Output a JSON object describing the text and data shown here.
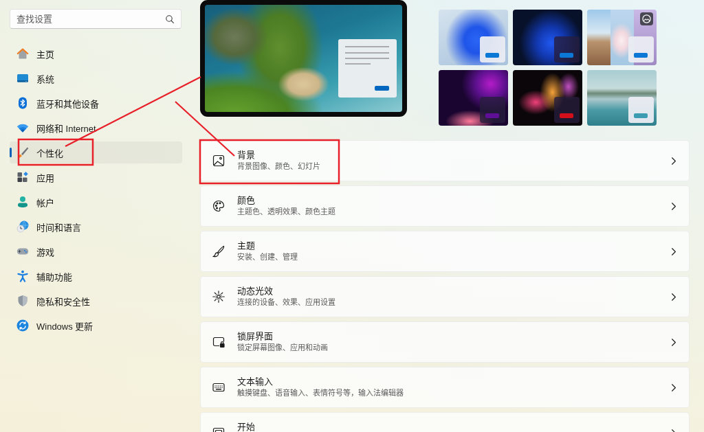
{
  "search": {
    "placeholder": "查找设置"
  },
  "nav": [
    {
      "label": "主页",
      "selected": false,
      "outlined": false
    },
    {
      "label": "系统",
      "selected": false,
      "outlined": false
    },
    {
      "label": "蓝牙和其他设备",
      "selected": false,
      "outlined": false
    },
    {
      "label": "网络和 Internet",
      "selected": false,
      "outlined": false
    },
    {
      "label": "个性化",
      "selected": true,
      "outlined": true
    },
    {
      "label": "应用",
      "selected": false,
      "outlined": false
    },
    {
      "label": "帐户",
      "selected": false,
      "outlined": false
    },
    {
      "label": "时间和语言",
      "selected": false,
      "outlined": false
    },
    {
      "label": "游戏",
      "selected": false,
      "outlined": false
    },
    {
      "label": "辅助功能",
      "selected": false,
      "outlined": false
    },
    {
      "label": "隐私和安全性",
      "selected": false,
      "outlined": false
    },
    {
      "label": "Windows 更新",
      "selected": false,
      "outlined": false
    }
  ],
  "themes": [
    {
      "dark": false,
      "color": "#0a78d4",
      "slideshow": false,
      "selected": false
    },
    {
      "dark": true,
      "color": "#0a78d4",
      "slideshow": false,
      "selected": false
    },
    {
      "dark": false,
      "color": "#0a78d4",
      "slideshow": true,
      "selected": false
    },
    {
      "dark": true,
      "color": "#5e0f96",
      "slideshow": false,
      "selected": false
    },
    {
      "dark": true,
      "color": "#d40f1c",
      "slideshow": false,
      "selected": false
    },
    {
      "dark": false,
      "color": "#3c9db2",
      "slideshow": false,
      "selected": false
    }
  ],
  "rows": [
    {
      "title": "背景",
      "subtitle": "背景图像、颜色、幻灯片",
      "outlined": true
    },
    {
      "title": "颜色",
      "subtitle": "主题色、透明效果、颜色主题",
      "outlined": false
    },
    {
      "title": "主题",
      "subtitle": "安装、创建、管理",
      "outlined": false
    },
    {
      "title": "动态光效",
      "subtitle": "连接的设备、效果、应用设置",
      "outlined": false
    },
    {
      "title": "锁屏界面",
      "subtitle": "锁定屏幕图像、应用和动画",
      "outlined": false
    },
    {
      "title": "文本输入",
      "subtitle": "触摸键盘、语音输入、表情符号等，输入法编辑器",
      "outlined": false
    },
    {
      "title": "开始",
      "outlined": false
    }
  ],
  "annotation_lines": true
}
